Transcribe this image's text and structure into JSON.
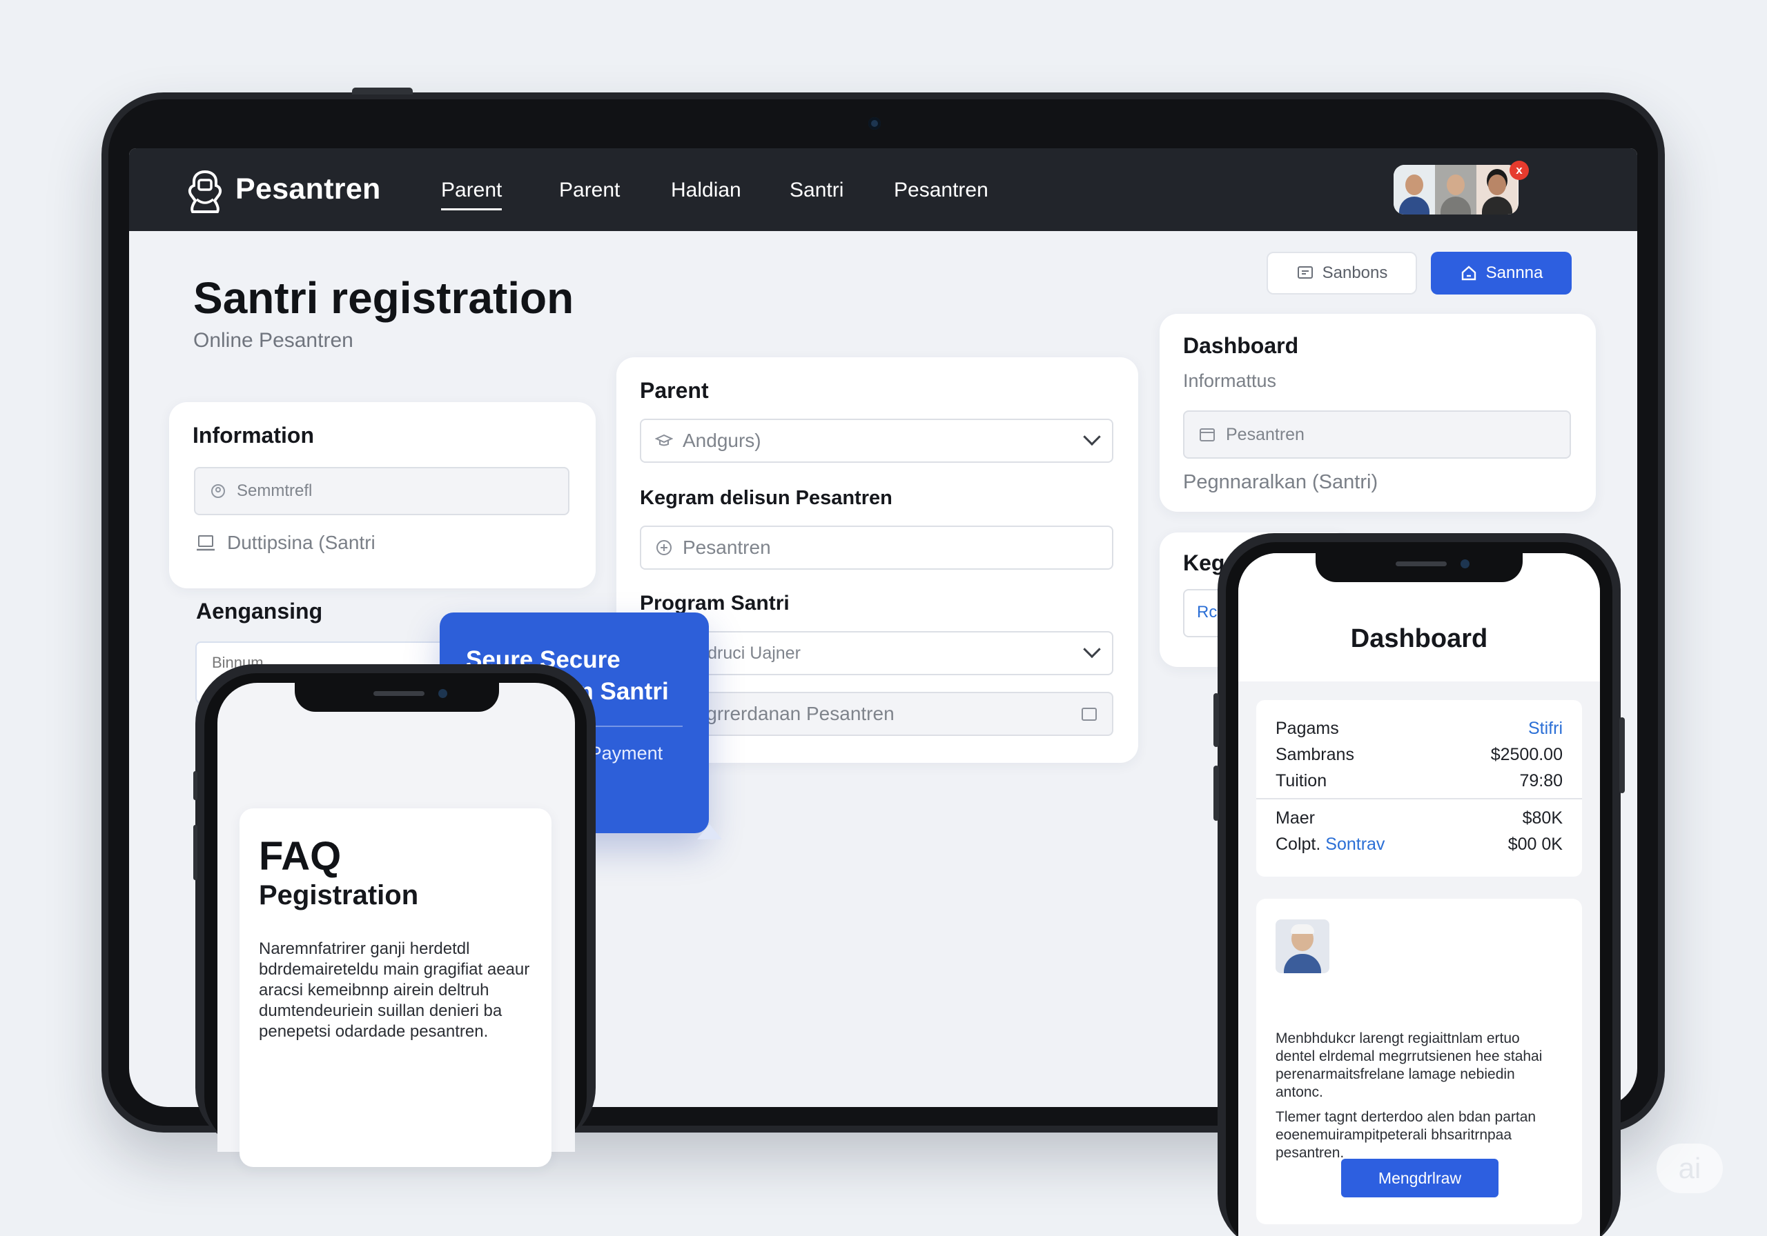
{
  "nav": {
    "brand": "Pesantren",
    "items": [
      {
        "label": "Parent",
        "active": true
      },
      {
        "label": "Parent",
        "active": false
      },
      {
        "label": "Haldian",
        "active": false
      },
      {
        "label": "Santri",
        "active": false
      },
      {
        "label": "Pesantren",
        "active": false
      }
    ],
    "close_badge": "x"
  },
  "header": {
    "title": "Santri registration",
    "subtitle": "Online Pesantren",
    "outline_button": "Sanbons",
    "primary_button": "Sannna"
  },
  "info_card": {
    "title": "Information",
    "field_placeholder": "Semmtrefl",
    "row_text": "Duttipsina (Santri"
  },
  "aengansing": {
    "title": "Aengansing",
    "field_text": "Binnum"
  },
  "form": {
    "parent_label": "Parent",
    "parent_select": "Andgurs)",
    "kegiram_label": "Kegram delisun Pesantren",
    "kegiram_placeholder": "Pesantren",
    "program_label": "Program Santri",
    "program_select": "Saidruci Uajner",
    "extra_placeholder": "Pegrrerdanan Pesantren"
  },
  "dashboard_card": {
    "title": "Dashboard",
    "subtitle": "Informattus",
    "field": "Pesantren",
    "footer": "Pegnnaralkan (Santri)"
  },
  "dashboard_card2": {
    "title": "Keg",
    "field": "Rc"
  },
  "tooltip": {
    "title": "Seure Secure Onynertian Santri",
    "body": "Heypet Online Payment Pesantren"
  },
  "faq": {
    "title": "FAQ",
    "subtitle": "Pegistration",
    "body": "Naremnfatrirer ganji herdetdl bdrdemaireteldu main gragifiat aeaur aracsi kemeibnnp airein deltruh dumtendeuriein suillan denieri ba penepetsi odardade pesantren."
  },
  "phone_dashboard": {
    "title": "Dashboard",
    "rows": [
      {
        "label": "Pagams",
        "value": "Stifri",
        "value_blue": true
      },
      {
        "label": "Sambrans",
        "value": "$2500.00"
      },
      {
        "label": "Tuition",
        "value": "79:80"
      },
      {
        "label": "Maer",
        "value": "$80K"
      },
      {
        "label": "Colpt.",
        "label_blue": "Sontrav",
        "value": "$00 0K"
      }
    ],
    "para1": "Menbhdukcr larengt regiaittnlam ertuo dentel elrdemal megrrutsienen hee stahai perenarmaitsfrelane lamage nebiedin antonc.",
    "para2": "Tlemer tagnt derterdoo alen bdan partan eoenemuirampitpeterali bhsaritrnpaa pesantren.",
    "button": "Mengdrlraw"
  },
  "badge": "ai",
  "colors": {
    "primary": "#2d5fe0",
    "nav_bg": "#22252b",
    "page_bg": "#eef1f5"
  }
}
